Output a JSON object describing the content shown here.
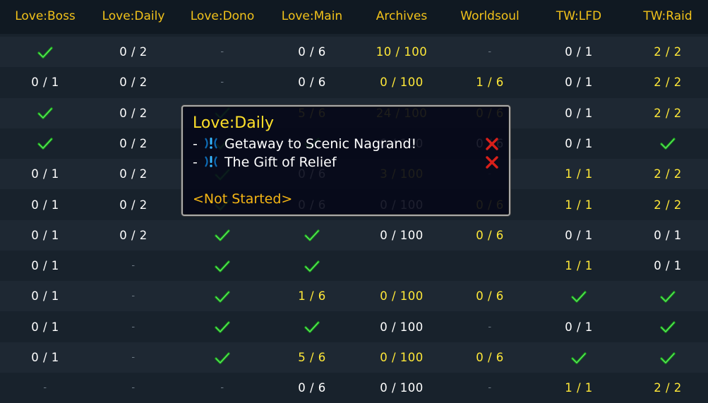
{
  "colors": {
    "header_text": "#f2c21a",
    "complete_check": "#19b219",
    "incomplete_value": "#ffffff",
    "progress_value": "#ffe838",
    "tooltip_status": "#f5b614",
    "fail_x": "#d8201a"
  },
  "columns": [
    "Love:Boss",
    "Love:Daily",
    "Love:Dono",
    "Love:Main",
    "Archives",
    "Worldsoul",
    "TW:LFD",
    "TW:Raid"
  ],
  "rows": [
    [
      {
        "t": "check"
      },
      {
        "t": "w",
        "v": "0 / 2"
      },
      {
        "t": "dash",
        "v": "-"
      },
      {
        "t": "w",
        "v": "0 / 6"
      },
      {
        "t": "y",
        "v": "10 / 100"
      },
      {
        "t": "dash",
        "v": "-"
      },
      {
        "t": "w",
        "v": "0 / 1"
      },
      {
        "t": "y",
        "v": "2 / 2"
      }
    ],
    [
      {
        "t": "w",
        "v": "0 / 1"
      },
      {
        "t": "w",
        "v": "0 / 2"
      },
      {
        "t": "dash",
        "v": "-"
      },
      {
        "t": "w",
        "v": "0 / 6"
      },
      {
        "t": "y",
        "v": "0 / 100"
      },
      {
        "t": "y",
        "v": "1 / 6"
      },
      {
        "t": "w",
        "v": "0 / 1"
      },
      {
        "t": "y",
        "v": "2 / 2"
      }
    ],
    [
      {
        "t": "check"
      },
      {
        "t": "w",
        "v": "0 / 2"
      },
      {
        "t": "check"
      },
      {
        "t": "y",
        "v": "5 / 6"
      },
      {
        "t": "y",
        "v": "24 / 100"
      },
      {
        "t": "y",
        "v": "0 / 6"
      },
      {
        "t": "w",
        "v": "0 / 1"
      },
      {
        "t": "y",
        "v": "2 / 2"
      }
    ],
    [
      {
        "t": "check"
      },
      {
        "t": "w",
        "v": "0 / 2"
      },
      {
        "t": "check"
      },
      {
        "t": "check"
      },
      {
        "t": "w",
        "v": "0 / 100"
      },
      {
        "t": "w",
        "v": "0 / 6"
      },
      {
        "t": "w",
        "v": "0 / 1"
      },
      {
        "t": "check"
      }
    ],
    [
      {
        "t": "w",
        "v": "0 / 1"
      },
      {
        "t": "w",
        "v": "0 / 2"
      },
      {
        "t": "check"
      },
      {
        "t": "w",
        "v": "0 / 6"
      },
      {
        "t": "y",
        "v": "3 / 100"
      },
      {
        "t": "dash",
        "v": "-"
      },
      {
        "t": "y",
        "v": "1 / 1"
      },
      {
        "t": "y",
        "v": "2 / 2"
      }
    ],
    [
      {
        "t": "w",
        "v": "0 / 1"
      },
      {
        "t": "w",
        "v": "0 / 2"
      },
      {
        "t": "check"
      },
      {
        "t": "w",
        "v": "0 / 6"
      },
      {
        "t": "w",
        "v": "0 / 100"
      },
      {
        "t": "y",
        "v": "0 / 6"
      },
      {
        "t": "y",
        "v": "1 / 1"
      },
      {
        "t": "y",
        "v": "2 / 2"
      }
    ],
    [
      {
        "t": "w",
        "v": "0 / 1"
      },
      {
        "t": "w",
        "v": "0 / 2"
      },
      {
        "t": "check"
      },
      {
        "t": "check"
      },
      {
        "t": "w",
        "v": "0 / 100"
      },
      {
        "t": "y",
        "v": "0 / 6"
      },
      {
        "t": "w",
        "v": "0 / 1"
      },
      {
        "t": "w",
        "v": "0 / 1"
      }
    ],
    [
      {
        "t": "w",
        "v": "0 / 1"
      },
      {
        "t": "dash",
        "v": "-"
      },
      {
        "t": "check"
      },
      {
        "t": "check"
      },
      {
        "t": "empty"
      },
      {
        "t": "empty"
      },
      {
        "t": "y",
        "v": "1 / 1"
      },
      {
        "t": "w",
        "v": "0 / 1"
      }
    ],
    [
      {
        "t": "w",
        "v": "0 / 1"
      },
      {
        "t": "dash",
        "v": "-"
      },
      {
        "t": "check"
      },
      {
        "t": "y",
        "v": "1 / 6"
      },
      {
        "t": "y",
        "v": "0 / 100"
      },
      {
        "t": "y",
        "v": "0 / 6"
      },
      {
        "t": "check"
      },
      {
        "t": "check"
      }
    ],
    [
      {
        "t": "w",
        "v": "0 / 1"
      },
      {
        "t": "dash",
        "v": "-"
      },
      {
        "t": "check"
      },
      {
        "t": "check"
      },
      {
        "t": "w",
        "v": "0 / 100"
      },
      {
        "t": "dash",
        "v": "-"
      },
      {
        "t": "w",
        "v": "0 / 1"
      },
      {
        "t": "check"
      }
    ],
    [
      {
        "t": "w",
        "v": "0 / 1"
      },
      {
        "t": "dash",
        "v": "-"
      },
      {
        "t": "check"
      },
      {
        "t": "y",
        "v": "5 / 6"
      },
      {
        "t": "y",
        "v": "0 / 100"
      },
      {
        "t": "y",
        "v": "0 / 6"
      },
      {
        "t": "check"
      },
      {
        "t": "check"
      }
    ],
    [
      {
        "t": "dash",
        "v": "-"
      },
      {
        "t": "dash",
        "v": "-"
      },
      {
        "t": "dash",
        "v": "-"
      },
      {
        "t": "w",
        "v": "0 / 6"
      },
      {
        "t": "w",
        "v": "0 / 100"
      },
      {
        "t": "dash",
        "v": "-"
      },
      {
        "t": "y",
        "v": "1 / 1"
      },
      {
        "t": "y",
        "v": "2 / 2"
      }
    ]
  ],
  "tooltip": {
    "title": "Love:Daily",
    "quests": [
      {
        "prefix": "- ",
        "icon": "quest-available-icon",
        "name": "Getaway to Scenic Nagrand!",
        "status_icon": "red-x-icon"
      },
      {
        "prefix": "- ",
        "icon": "quest-available-icon",
        "name": "The Gift of Relief",
        "status_icon": "red-x-icon"
      }
    ],
    "status": "<Not Started>"
  }
}
